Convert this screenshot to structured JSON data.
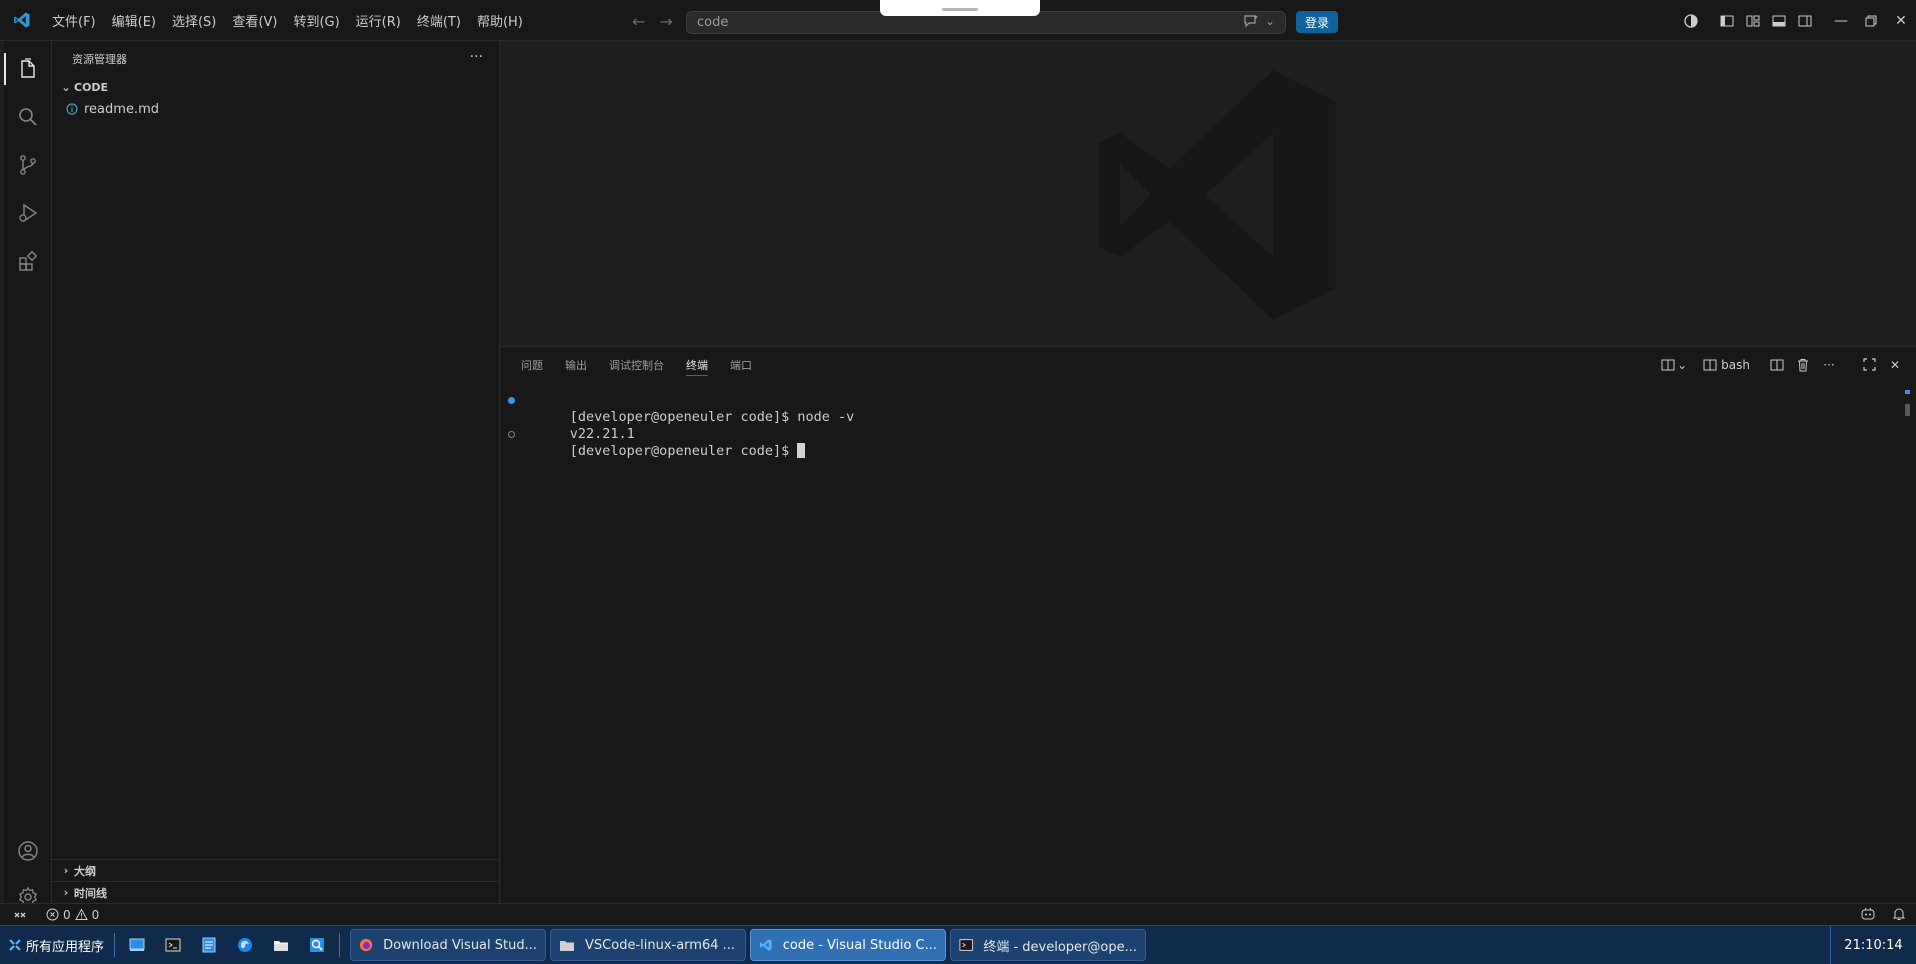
{
  "titlebar": {
    "menus": [
      "文件(F)",
      "编辑(E)",
      "选择(S)",
      "查看(V)",
      "转到(G)",
      "运行(R)",
      "终端(T)",
      "帮助(H)"
    ],
    "search_text": "code",
    "signin_label": "登录"
  },
  "sidebar": {
    "title": "资源管理器",
    "folder": "CODE",
    "files": [
      {
        "name": "readme.md",
        "icon": "info-icon"
      }
    ],
    "bottom_sections": [
      "大纲",
      "时间线"
    ]
  },
  "panel": {
    "tabs": [
      "问题",
      "输出",
      "调试控制台",
      "终端",
      "端口"
    ],
    "active_tab": "终端",
    "shell_label": "bash",
    "terminal_lines": [
      {
        "text": "[developer@openeuler code]$ node -v",
        "decor": "filled"
      },
      {
        "text": "v22.21.1",
        "decor": "none"
      },
      {
        "text": "[developer@openeuler code]$ ",
        "decor": "empty",
        "cursor": true
      }
    ]
  },
  "statusbar": {
    "errors": "0",
    "warnings": "0"
  },
  "taskbar": {
    "start_label": "所有应用程序",
    "tasks": [
      {
        "label": "Download Visual Stud...",
        "icon": "firefox-icon",
        "active": false
      },
      {
        "label": "VSCode-linux-arm64 ...",
        "icon": "folder-icon",
        "active": false
      },
      {
        "label": "code - Visual Studio C...",
        "icon": "vscode-icon",
        "active": true
      },
      {
        "label": "终端 - developer@ope...",
        "icon": "terminal-icon",
        "active": false
      }
    ],
    "clock": "21:10:14"
  },
  "colors": {
    "accent": "#0078d4",
    "signin_button": "#0e639c",
    "taskbar": "#0f2a4a",
    "editor_bg": "#1f1f1f",
    "sidebar_bg": "#181818"
  }
}
